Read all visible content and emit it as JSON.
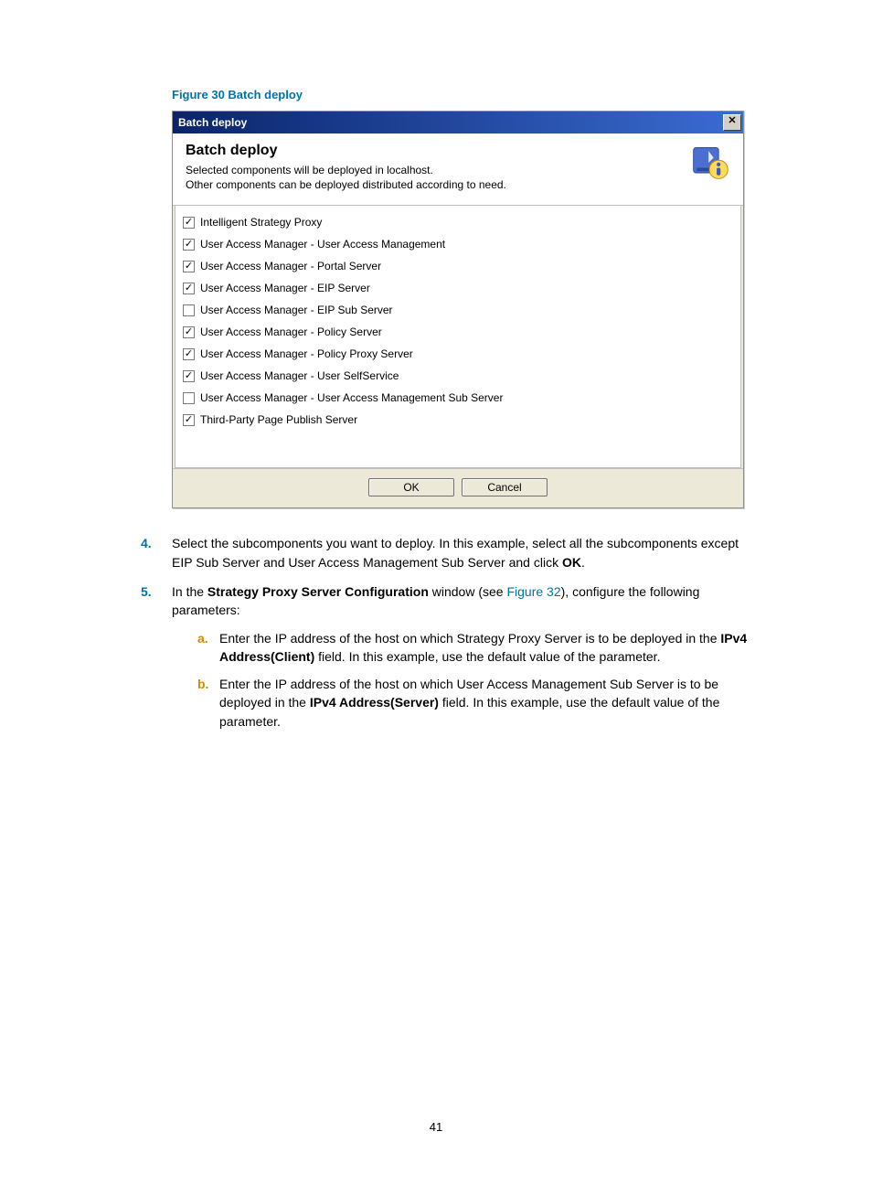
{
  "figure_caption": "Figure 30 Batch deploy",
  "dialog": {
    "title": "Batch deploy",
    "header_title": "Batch deploy",
    "header_line1": "Selected components will be deployed in localhost.",
    "header_line2": "Other components can be deployed distributed according to need.",
    "components": [
      {
        "label": "Intelligent Strategy Proxy",
        "checked": true
      },
      {
        "label": "User Access Manager - User Access Management",
        "checked": true
      },
      {
        "label": "User Access Manager - Portal Server",
        "checked": true
      },
      {
        "label": "User Access Manager - EIP Server",
        "checked": true
      },
      {
        "label": "User Access Manager - EIP Sub Server",
        "checked": false
      },
      {
        "label": "User Access Manager - Policy Server",
        "checked": true
      },
      {
        "label": "User Access Manager - Policy Proxy Server",
        "checked": true
      },
      {
        "label": "User Access Manager - User SelfService",
        "checked": true
      },
      {
        "label": "User Access Manager - User Access Management Sub Server",
        "checked": false
      },
      {
        "label": "Third-Party Page Publish Server",
        "checked": true
      }
    ],
    "ok_label": "OK",
    "cancel_label": "Cancel",
    "close_glyph": "✕"
  },
  "step4": {
    "num": "4.",
    "text_a": "Select the subcomponents you want to deploy. In this example, select all the subcomponents except EIP Sub Server and User Access Management Sub Server and click ",
    "text_b_bold": "OK",
    "text_c": "."
  },
  "step5": {
    "num": "5.",
    "intro_a": "In the ",
    "intro_bold": "Strategy Proxy Server Configuration",
    "intro_b": " window (see ",
    "intro_link": "Figure 32",
    "intro_c": "), configure the following parameters:",
    "sub_a": {
      "label": "a.",
      "t1": "Enter the IP address of the host on which Strategy Proxy Server is to be deployed in the ",
      "bold": "IPv4 Address(Client)",
      "t2": " field. In this example, use the default value of the parameter."
    },
    "sub_b": {
      "label": "b.",
      "t1": "Enter the IP address of the host on which User Access Management Sub Server is to be deployed in the ",
      "bold": "IPv4 Address(Server)",
      "t2": " field. In this example, use the default value of the parameter."
    }
  },
  "page_number": "41"
}
